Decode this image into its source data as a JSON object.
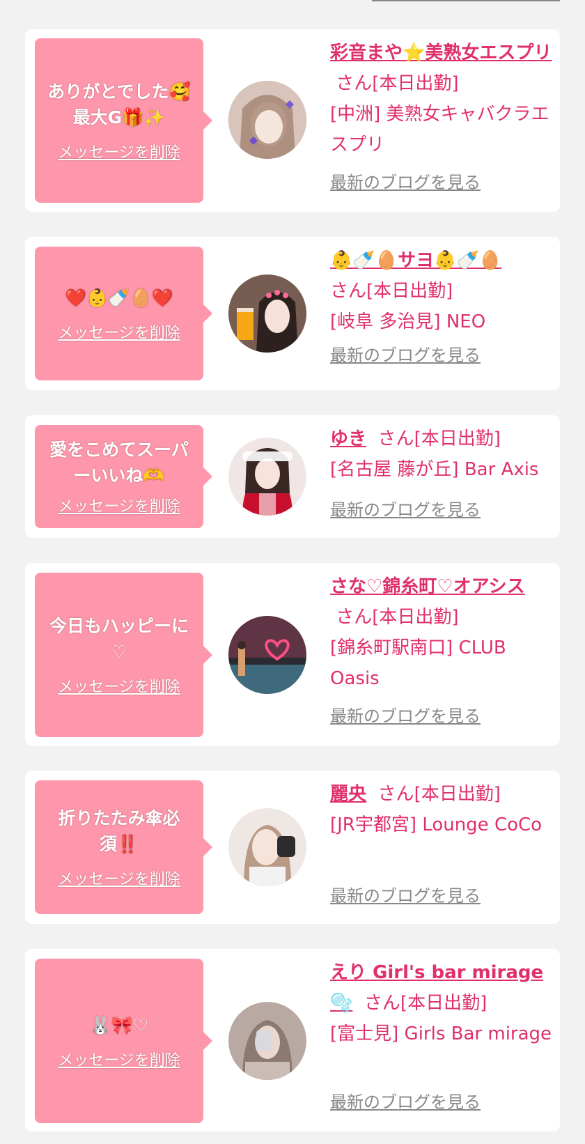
{
  "header": {
    "partial_text": "(…… )",
    "link_line": ""
  },
  "colors": {
    "accent": "#e0306a",
    "bubble": "#ff97ac",
    "link_gray": "#888888",
    "background": "#f2f2f2"
  },
  "cards": [
    {
      "message": "ありがとでした🥰最大G🎁✨",
      "delete_label": "メッセージを削除",
      "name": "彩音まや⭐美熟女エスプリ",
      "san": "さん",
      "status": "[本日出勤]",
      "shop": "[中洲] 美熟女キャバクラエスプリ",
      "blog_label": "最新のブログを見る"
    },
    {
      "message": "❤️👶🍼🥚❤️",
      "delete_label": "メッセージを削除",
      "name": "👶🍼🥚サヨ👶🍼🥚",
      "san": "さん",
      "status": "[本日出勤]",
      "shop": "[岐阜 多治見] NEO",
      "blog_label": "最新のブログを見る"
    },
    {
      "message": "愛をこめてスーパーいいね🫶",
      "delete_label": "メッセージを削除",
      "name": "ゆき",
      "san": "さん",
      "status": "[本日出勤]",
      "shop": "[名古屋 藤が丘] Bar Axis",
      "blog_label": "最新のブログを見る"
    },
    {
      "message": "今日もハッピーに♡",
      "delete_label": "メッセージを削除",
      "name": "さな♡錦糸町♡オアシス",
      "san": "さん",
      "status": "[本日出勤]",
      "shop": "[錦糸町駅南口] CLUB Oasis",
      "blog_label": "最新のブログを見る"
    },
    {
      "message": "折りたたみ傘必須‼️",
      "delete_label": "メッセージを削除",
      "name": "麗央",
      "san": "さん",
      "status": "[本日出勤]",
      "shop": "[JR宇都宮] Lounge CoCo",
      "blog_label": "最新のブログを見る"
    },
    {
      "message": "🐰🎀♡",
      "delete_label": "メッセージを削除",
      "name": "えり Girl's bar mirage 🫧",
      "san": "さん",
      "status": "[本日出勤]",
      "shop": "[富士見] Girls Bar mirage",
      "blog_label": "最新のブログを見る"
    }
  ]
}
